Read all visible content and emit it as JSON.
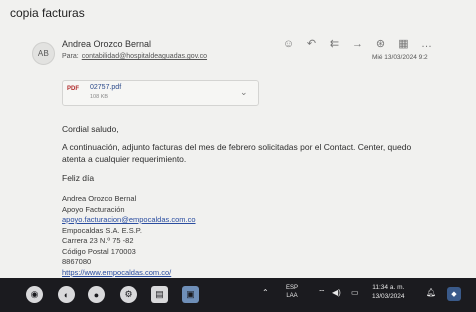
{
  "email": {
    "subject": "copia facturas",
    "avatar_initials": "AB",
    "sender_name": "Andrea Orozco Bernal",
    "to_label": "Para:",
    "to_address": "contabilidad@hospitaldeaguadas.gov.co",
    "date": "Mié 13/03/2024 9:2",
    "toolbar_icons": [
      "smile-icon",
      "reply-icon",
      "reply-all-icon",
      "forward-icon",
      "teams-icon",
      "grid-icon",
      "more-icon"
    ]
  },
  "attachment": {
    "icon_text": "PDF",
    "file_name": "02757.pdf",
    "file_size": "108 KB"
  },
  "body": {
    "greeting": "Cordial saludo,",
    "paragraph": "A continuación, adjunto facturas del mes de febrero solicitadas por el Contact. Center, quedo atenta a cualquier requerimiento.",
    "closing": "Feliz día"
  },
  "signature": {
    "name": "Andrea Orozco Bernal",
    "role": "Apoyo Facturación",
    "email": "apoyo.facturacion@empocaldas.com.co",
    "company": "Empocaldas S.A. E.S.P.",
    "address": "Carrera 23 N.º 75 -82",
    "postal": "Código Postal 170003",
    "phone": "8867080",
    "website": "https://www.empocaldas.com.co/"
  },
  "taskbar": {
    "apps": [
      "chrome-icon",
      "edge-icon",
      "chrome-icon-2",
      "settings-icon",
      "notes-icon",
      "file-explorer-icon"
    ],
    "language": "ESP",
    "layout": "LAA",
    "time": "11:34 a. m.",
    "date": "13/03/2024"
  }
}
